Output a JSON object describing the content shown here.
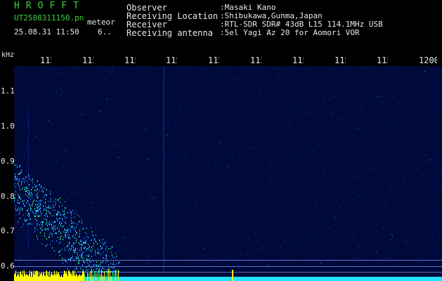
{
  "header": {
    "app_title": "HROFFT",
    "file_name": "UT2508311150.pn",
    "file_kind": "meteor",
    "file_datetime": "25.08.31 11:50",
    "file_extra": "6.."
  },
  "station_info": [
    {
      "label": "Observer",
      "value": ":Masaki Kano"
    },
    {
      "label": "Receiving Location",
      "value": ":Shibukawa,Gunma,Japan"
    },
    {
      "label": "Receiver",
      "value": ":RTL-SDR SDR# 43dB L15 114.1MHz USB"
    },
    {
      "label": "Receiving antenna",
      "value": ":5el Yagi Az 20 for Aomori VOR"
    }
  ],
  "freq_axis": {
    "unit": "kHz",
    "ticks": [
      "115",
      "115",
      "115",
      "115",
      "115",
      "115",
      "115",
      "115",
      "115",
      "1200"
    ]
  },
  "y_axis": {
    "labels": [
      "1.1",
      "1.0",
      "0.9",
      "0.8",
      "0.7",
      "0.6"
    ]
  },
  "colors": {
    "text_green": "#3ad43a",
    "text_white": "#e8e8e8",
    "background": "#000000",
    "waterfall_bg": "#00001c",
    "signal_cyan": "#22e0ff",
    "signal_yellow": "#ffff00",
    "signal_green": "#30ff60"
  }
}
